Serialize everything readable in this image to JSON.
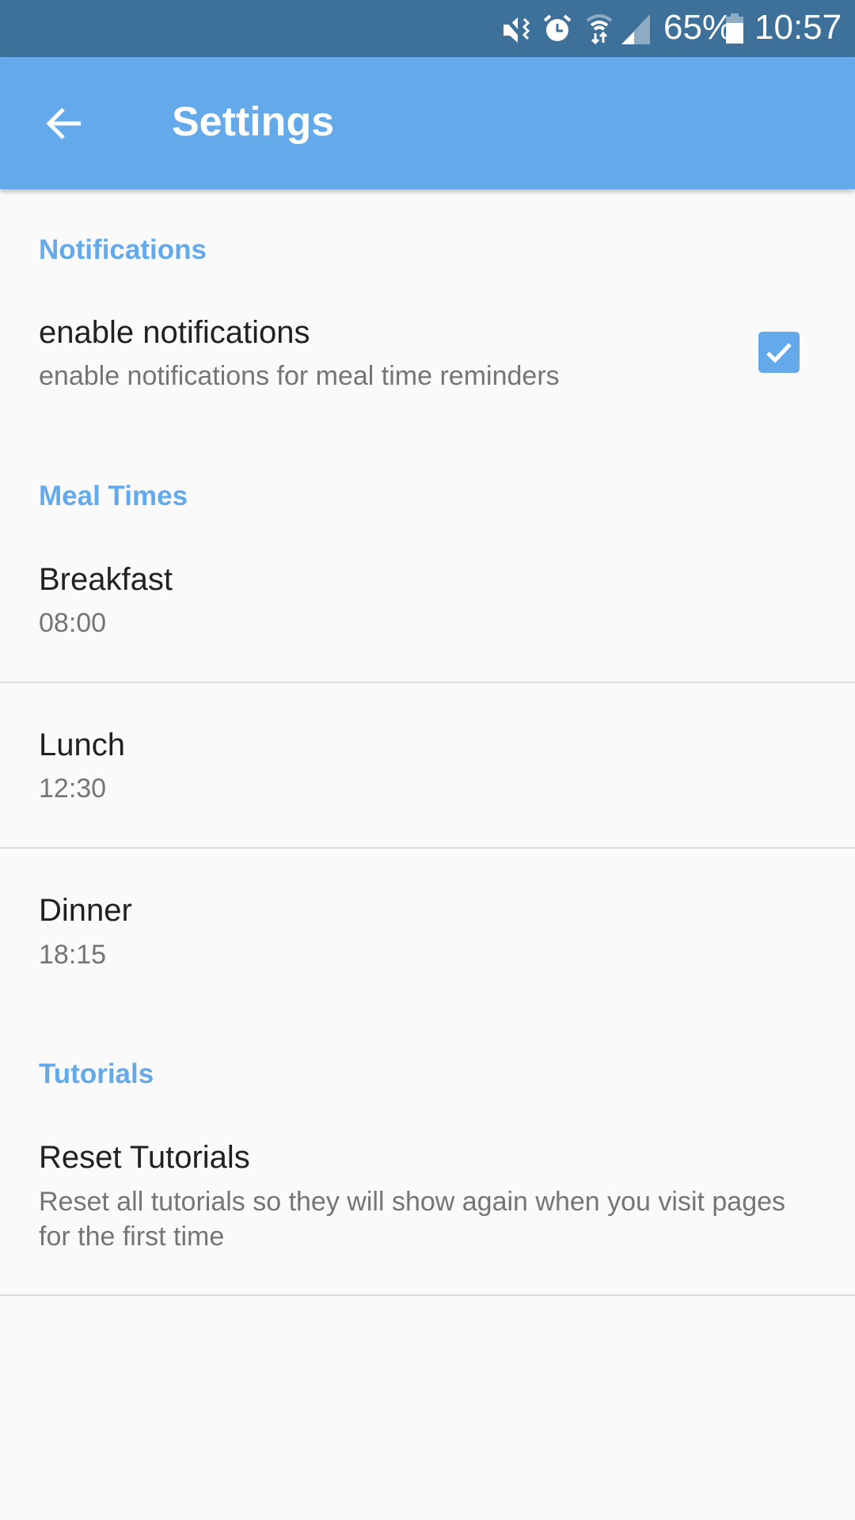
{
  "status_bar": {
    "battery": "65%",
    "time": "10:57",
    "icons": [
      "mute-icon",
      "alarm-icon",
      "wifi-icon",
      "signal-icon",
      "battery-icon"
    ]
  },
  "app_bar": {
    "title": "Settings",
    "back_icon": "arrow-left-icon"
  },
  "sections": {
    "notifications": {
      "header": "Notifications",
      "enable": {
        "title": "enable notifications",
        "summary": "enable notifications for meal time reminders",
        "checked": true
      }
    },
    "meal_times": {
      "header": "Meal Times",
      "items": [
        {
          "title": "Breakfast",
          "value": "08:00"
        },
        {
          "title": "Lunch",
          "value": "12:30"
        },
        {
          "title": "Dinner",
          "value": "18:15"
        }
      ]
    },
    "tutorials": {
      "header": "Tutorials",
      "reset": {
        "title": "Reset Tutorials",
        "summary": "Reset all tutorials so they will show again when you visit pages for the first time"
      }
    }
  },
  "colors": {
    "accent": "#64aaeb",
    "status_bar": "#3e7199"
  }
}
